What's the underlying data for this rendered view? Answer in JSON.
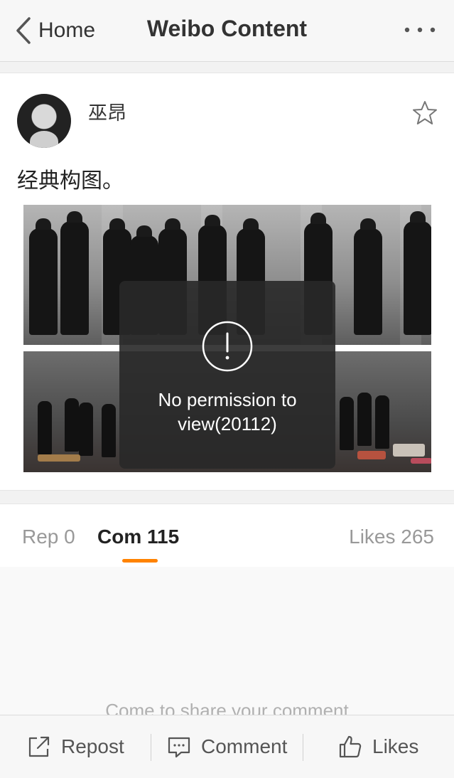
{
  "nav": {
    "back_label": "Home",
    "title": "Weibo Content",
    "more_icon": "more-dots-icon"
  },
  "post": {
    "username": "巫昂",
    "text": "经典构图。",
    "favorite_icon": "star-outline-icon"
  },
  "toast": {
    "icon": "exclamation-circle-icon",
    "message": "No permission to view(20112)"
  },
  "tabs": [
    {
      "label": "Rep 0"
    },
    {
      "label": "Com 115"
    },
    {
      "label": "Likes 265"
    }
  ],
  "active_tab": "Com 115",
  "comment_prompt": "Come to share your comment",
  "bottom_bar": {
    "repost_label": "Repost",
    "comment_label": "Comment",
    "likes_label": "Likes"
  },
  "colors": {
    "accent": "#ff8200",
    "toast_bg": "#282828"
  }
}
